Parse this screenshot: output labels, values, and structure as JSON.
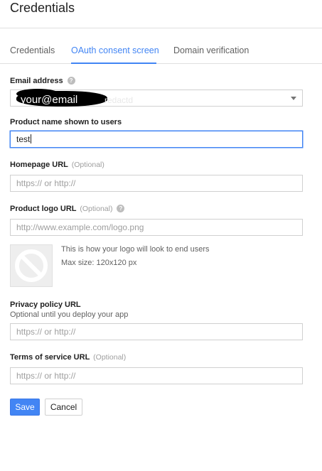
{
  "page": {
    "title": "Credentials"
  },
  "tabs": [
    {
      "label": "Credentials",
      "active": false
    },
    {
      "label": "OAuth consent screen",
      "active": true
    },
    {
      "label": "Domain verification",
      "active": false
    }
  ],
  "form": {
    "email": {
      "label": "Email address",
      "value": "your@email",
      "ghost": "redactd"
    },
    "product_name": {
      "label": "Product name shown to users",
      "value": "test"
    },
    "homepage_url": {
      "label": "Homepage URL",
      "optional": "(Optional)",
      "placeholder": "https:// or http://"
    },
    "logo_url": {
      "label": "Product logo URL",
      "optional": "(Optional)",
      "placeholder": "http://www.example.com/logo.png"
    },
    "logo_preview": {
      "line1": "This is how your logo will look to end users",
      "line2": "Max size: 120x120 px"
    },
    "privacy_url": {
      "label": "Privacy policy URL",
      "hint": "Optional until you deploy your app",
      "placeholder": "https:// or http://"
    },
    "tos_url": {
      "label": "Terms of service URL",
      "optional": "(Optional)",
      "placeholder": "https:// or http://"
    }
  },
  "actions": {
    "save": "Save",
    "cancel": "Cancel"
  },
  "colors": {
    "accent": "#4285f4",
    "border": "#d0d0d0",
    "muted": "#9e9e9e"
  }
}
